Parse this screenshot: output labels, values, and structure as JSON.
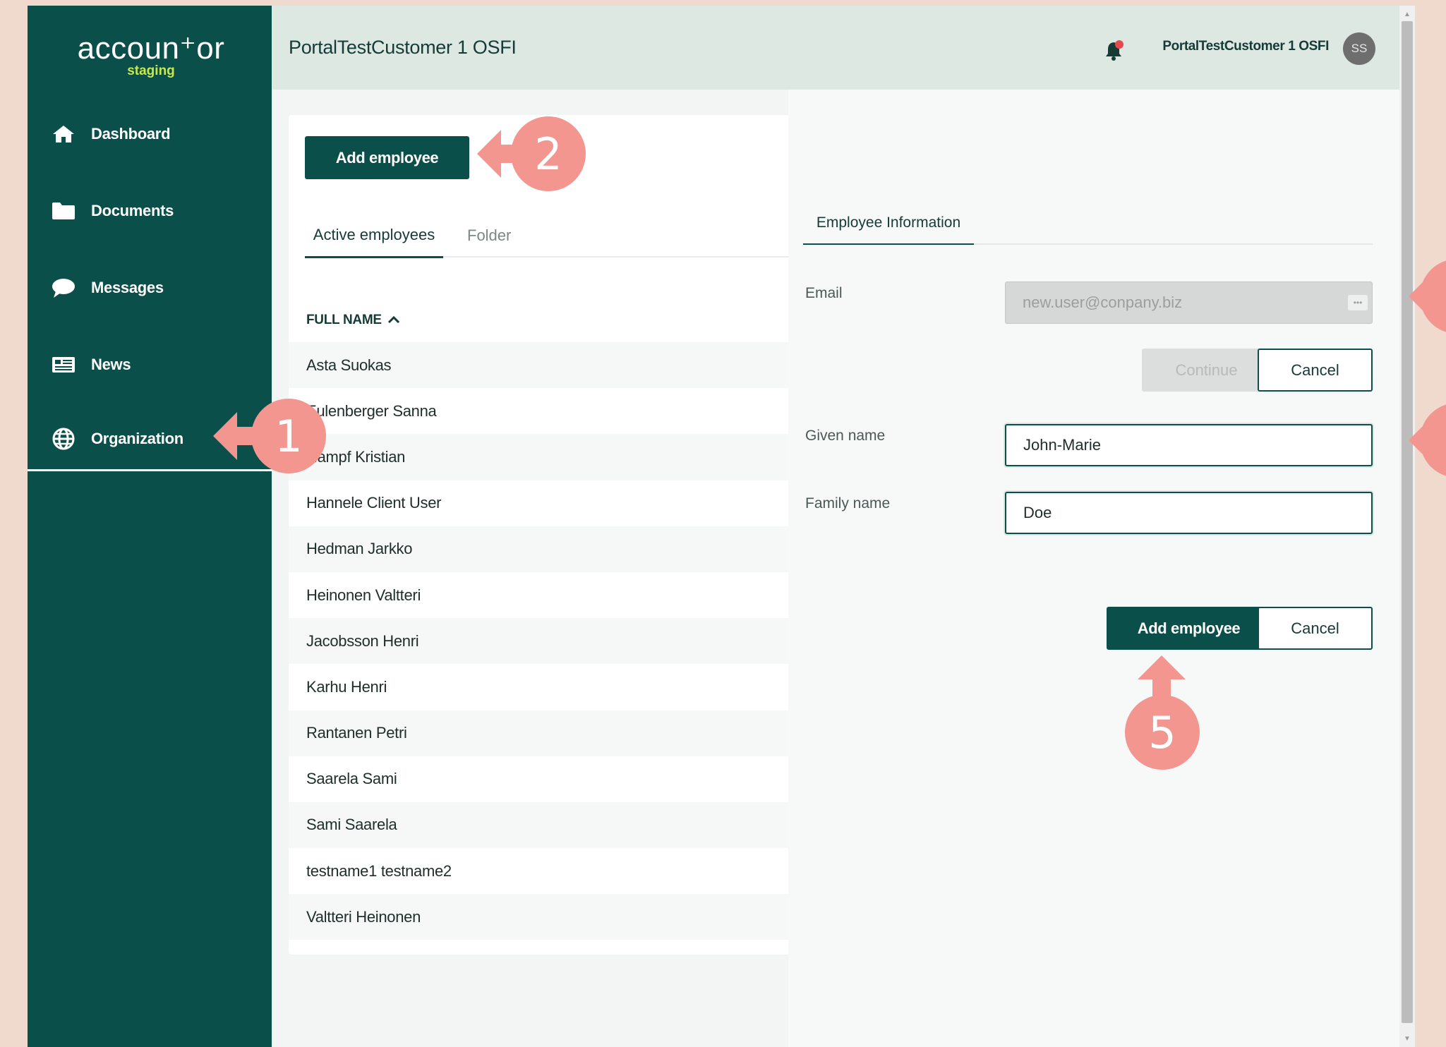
{
  "brand": {
    "logo_text": "accoun⁺or",
    "logo_sub": "staging"
  },
  "sidebar": {
    "items": [
      {
        "label": "Dashboard",
        "icon": "home-icon"
      },
      {
        "label": "Documents",
        "icon": "folder-icon"
      },
      {
        "label": "Messages",
        "icon": "chat-bubble-icon"
      },
      {
        "label": "News",
        "icon": "newspaper-icon"
      },
      {
        "label": "Organization",
        "icon": "globe-icon",
        "active": true
      }
    ]
  },
  "header": {
    "title": "PortalTestCustomer 1 OSFI",
    "user_name": "PortalTestCustomer 1 OSFI",
    "avatar_initials": "SS"
  },
  "employees": {
    "add_button": "Add employee",
    "tabs": [
      {
        "label": "Active employees",
        "active": true
      },
      {
        "label": "Folder"
      }
    ],
    "column_header": "FULL NAME",
    "rows": [
      "Asta Suokas",
      "Eulenberger Sanna",
      "Hampf Kristian",
      "Hannele Client User",
      "Hedman Jarkko",
      "Heinonen Valtteri",
      "Jacobsson Henri",
      "Karhu Henri",
      "Rantanen Petri",
      "Saarela Sami",
      "Sami Saarela",
      "testname1 testname2",
      "Valtteri Heinonen"
    ]
  },
  "panel": {
    "tab": "Employee Information",
    "email_label": "Email",
    "email_value": "new.user@conpany.biz",
    "continue_label": "Continue",
    "cancel_label": "Cancel",
    "given_name_label": "Given name",
    "given_name_value": "John-Marie",
    "family_name_label": "Family name",
    "family_name_value": "Doe",
    "add_button": "Add employee"
  },
  "annotations": {
    "step1": "1",
    "step2": "2",
    "step5": "5"
  },
  "colors": {
    "sidebar": "#0b4f4a",
    "header": "#dde8e3",
    "marker": "#f2968f",
    "logo_accent": "#c8e84d"
  }
}
